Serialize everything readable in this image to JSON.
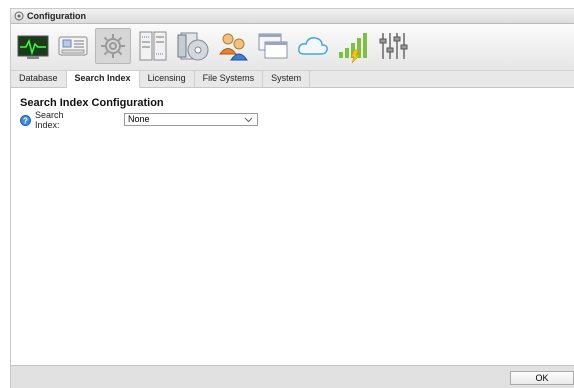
{
  "window": {
    "title": "Configuration"
  },
  "toolbar": {
    "icons": [
      {
        "name": "monitor-icon"
      },
      {
        "name": "server-icon"
      },
      {
        "name": "gear-icon",
        "selected": true
      },
      {
        "name": "rack-icon"
      },
      {
        "name": "disc-install-icon"
      },
      {
        "name": "users-icon"
      },
      {
        "name": "windows-icon"
      },
      {
        "name": "cloud-icon"
      },
      {
        "name": "signal-bars-icon"
      },
      {
        "name": "sliders-icon"
      }
    ]
  },
  "tabs": [
    {
      "label": "Database"
    },
    {
      "label": "Search Index",
      "active": true
    },
    {
      "label": "Licensing"
    },
    {
      "label": "File Systems"
    },
    {
      "label": "System"
    }
  ],
  "content": {
    "section_title": "Search Index Configuration",
    "field": {
      "label": "Search Index:",
      "value": "None"
    }
  },
  "footer": {
    "ok_label": "OK"
  }
}
